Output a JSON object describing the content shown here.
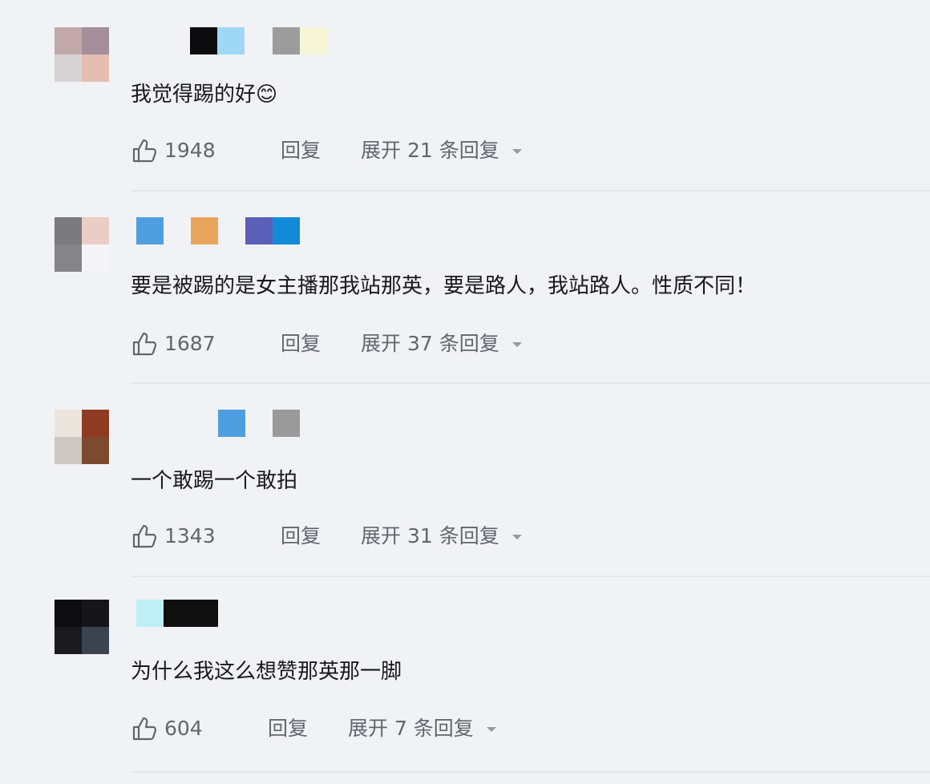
{
  "colors": {
    "background": "#f1f2f6",
    "text": "#18191c",
    "meta": "#61666d",
    "divider": "#e3e5e7"
  },
  "icons": {
    "like": "thumbs-up-icon",
    "expand": "caret-down-icon"
  },
  "comments": [
    {
      "text": "我觉得踢的好😊",
      "likes": "1948",
      "reply_label": "回复",
      "expand_label": "展开 21 条回复"
    },
    {
      "text": "要是被踢的是女主播那我站那英，要是路人，我站路人。性质不同！",
      "likes": "1687",
      "reply_label": "回复",
      "expand_label": "展开 37 条回复"
    },
    {
      "text": "一个敢踢一个敢拍",
      "likes": "1343",
      "reply_label": "回复",
      "expand_label": "展开 31 条回复"
    },
    {
      "text": "为什么我这么想赞那英那一脚",
      "likes": "604",
      "reply_label": "回复",
      "expand_label": "展开 7 条回复"
    }
  ]
}
